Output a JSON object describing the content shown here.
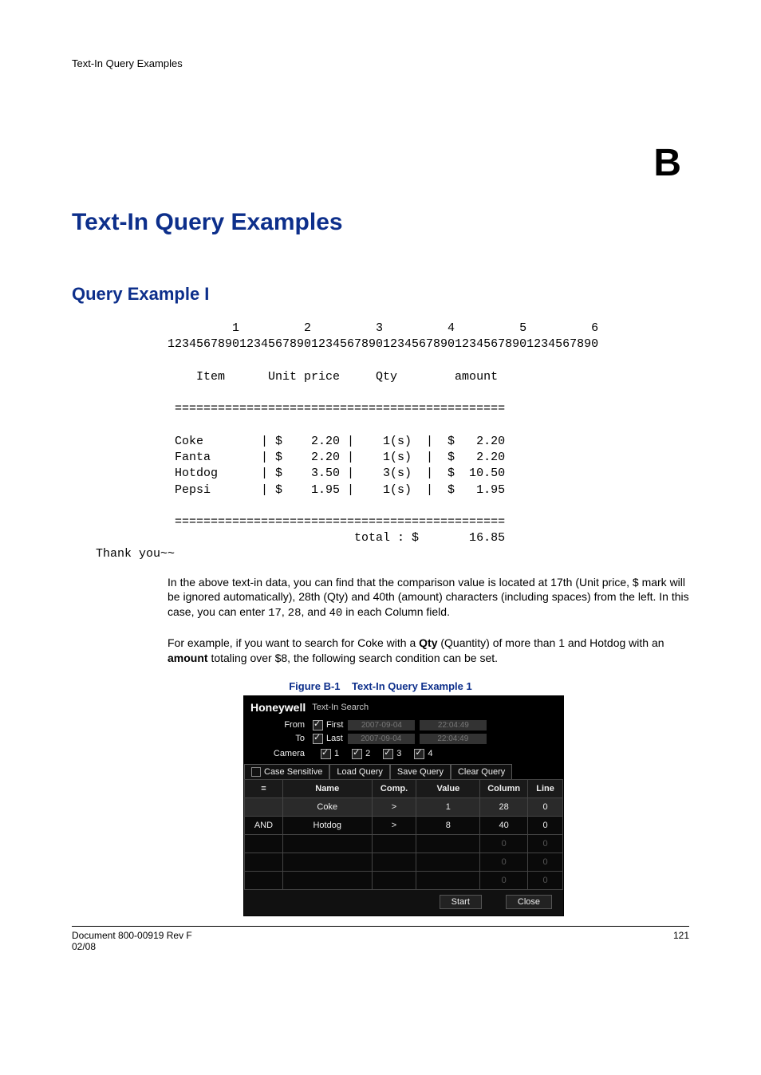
{
  "running_head": "Text-In Query Examples",
  "chapter_letter": "B",
  "chapter_title": "Text-In Query Examples",
  "section_title": "Query Example I",
  "receipt": {
    "ruler_top": "         1         2         3         4         5         6",
    "ruler_digits": "123456789012345678901234567890123456789012345678901234567890",
    "header": "    Item      Unit price     Qty        amount",
    "sep": " ==============================================",
    "rows": [
      " Coke        | $    2.20 |    1(s)  |  $   2.20",
      " Fanta       | $    2.20 |    1(s)  |  $   2.20",
      " Hotdog      | $    3.50 |    3(s)  |  $  10.50",
      " Pepsi       | $    1.95 |    1(s)  |  $   1.95"
    ],
    "total_line": "                          total : $       16.85",
    "thank": "Thank you~~"
  },
  "para1_before": "In the above text-in data, you can find that the comparison value is located at 17th (Unit price, $ mark will be ignored automatically), 28th (Qty) and 40th (amount) characters (including spaces) from the left. In this case, you can enter ",
  "para1_mono1": "17",
  "para1_mid1": ", ",
  "para1_mono2": "28",
  "para1_mid2": ", and ",
  "para1_mono3": "40",
  "para1_after": " in each Column field.",
  "para2_a": "For example, if you want to search for Coke with a ",
  "para2_qty": "Qty",
  "para2_b": " (Quantity) of more than 1 and Hotdog with an ",
  "para2_amount": "amount",
  "para2_c": " totaling over $8, the following search condition can be set.",
  "figure_label": "Figure B-1",
  "figure_title": "Text-In Query Example 1",
  "screenshot": {
    "brand": "Honeywell",
    "subtitle": "Text-In Search",
    "from_label": "From",
    "to_label": "To",
    "first": "First",
    "last": "Last",
    "date1": "2007-09-04",
    "time1": "22:04:49",
    "date2": "2007-09-04",
    "time2": "22:04:49",
    "camera_label": "Camera",
    "cams": [
      "1",
      "2",
      "3",
      "4"
    ],
    "tabs": [
      "Case Sensitive",
      "Load Query",
      "Save Query",
      "Clear Query"
    ],
    "cols": [
      "=",
      "Name",
      "Comp.",
      "Value",
      "Column",
      "Line"
    ],
    "rows": [
      {
        "op": "",
        "name": "Coke",
        "comp": ">",
        "value": "1",
        "column": "28",
        "line": "0"
      },
      {
        "op": "AND",
        "name": "Hotdog",
        "comp": ">",
        "value": "8",
        "column": "40",
        "line": "0"
      }
    ],
    "disabled_rows": 3,
    "start": "Start",
    "close": "Close"
  },
  "footer_left_1": "Document 800-00919 Rev F",
  "footer_left_2": "02/08",
  "footer_right": "121"
}
